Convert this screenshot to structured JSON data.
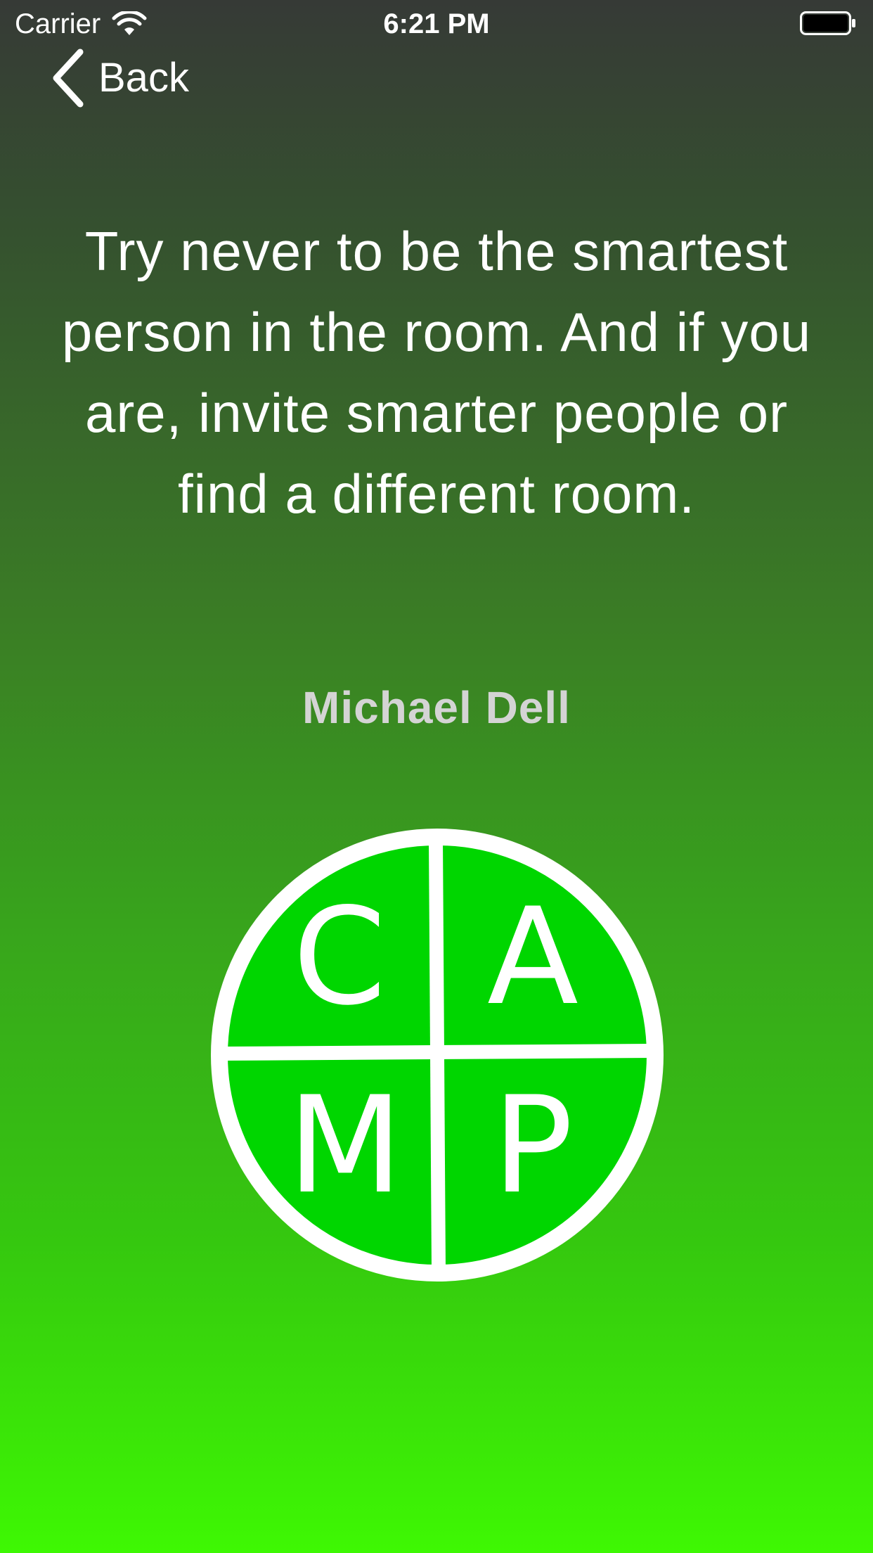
{
  "status_bar": {
    "carrier": "Carrier",
    "time": "6:21 PM"
  },
  "nav": {
    "back_label": "Back"
  },
  "quote": {
    "text": "Try never to be the smartest person in the room. And if you are, invite smarter people or find a different room.",
    "author": "Michael Dell"
  },
  "logo": {
    "letters": [
      "C",
      "A",
      "M",
      "P"
    ],
    "fill_color": "#00d600",
    "ring_color": "#ffffff"
  }
}
